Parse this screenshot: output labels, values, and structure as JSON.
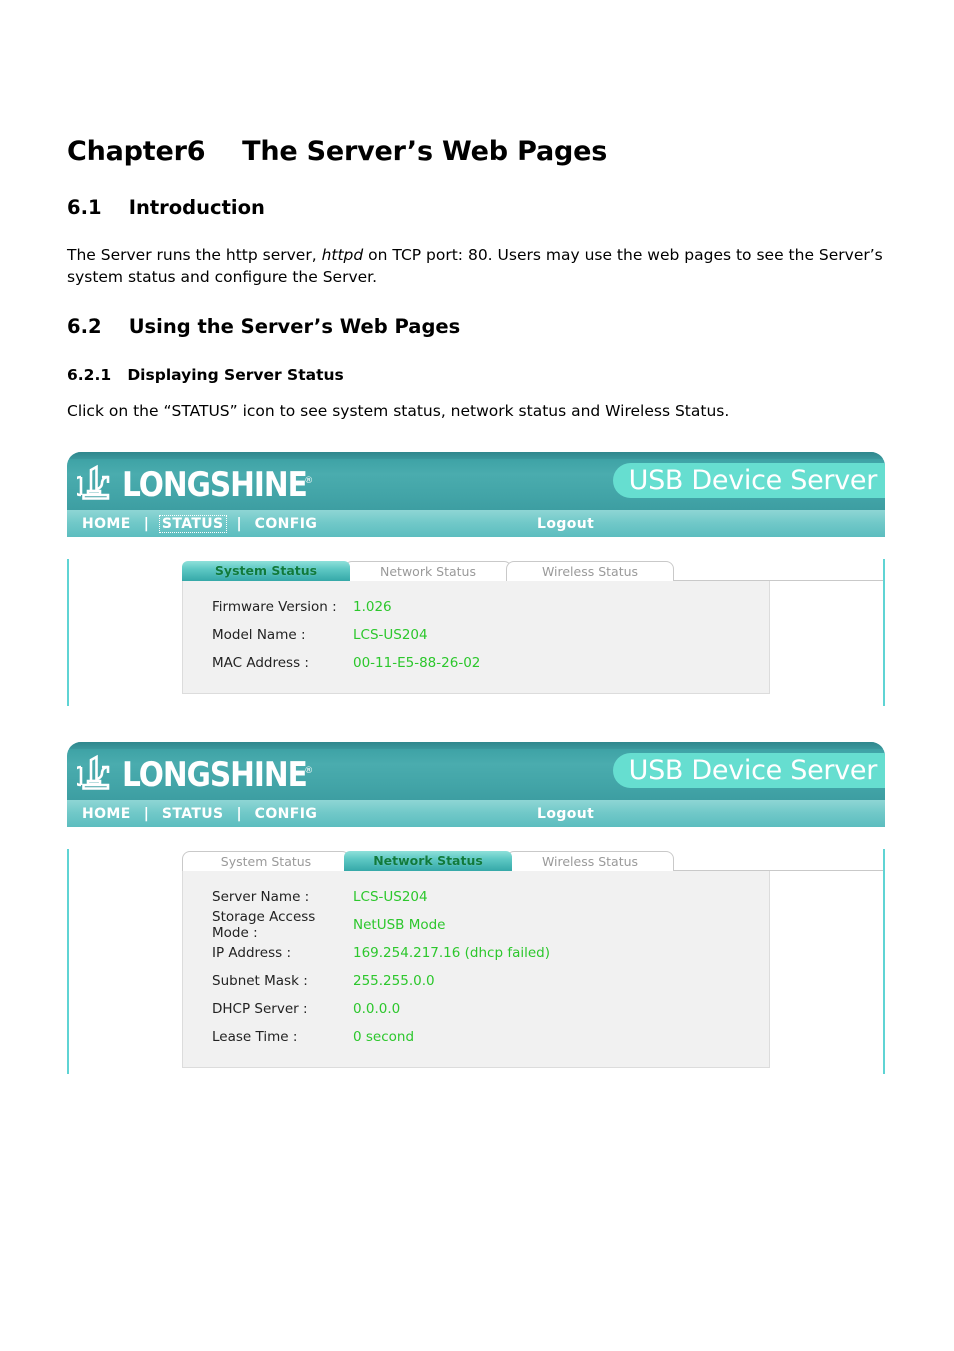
{
  "document": {
    "chapter_title": "Chapter6    The Server’s Web Pages",
    "section_61_title": "6.1    Introduction",
    "intro_paragraph": "The Server runs the http server, ",
    "intro_italic": "httpd",
    "intro_paragraph_cont": " on TCP port: 80. Users may use the web pages to see the Server’s system status and configure the Server.",
    "section_62_title": "6.2    Using the Server’s Web Pages",
    "section_621_title": "6.2.1   Displaying Server Status",
    "status_paragraph": "Click on the “STATUS” icon to see system status, network status and Wireless Status."
  },
  "colors": {
    "header_teal": "#43a5a8",
    "nav_teal": "#72c9c9",
    "badge_mint": "#66ded0",
    "border_teal": "#5fd4d4",
    "value_green": "#2cc72c",
    "active_tab_text": "#0f7a3c",
    "inactive_tab_text": "#9a9a9a",
    "field_bg": "#f1f1f1"
  },
  "screenshot1": {
    "logo_word": "LONGSHINE",
    "logo_registered": "®",
    "badge_label": "USB Device Server",
    "nav": {
      "items": [
        {
          "label": "HOME",
          "focused": false
        },
        {
          "label": "STATUS",
          "focused": true
        },
        {
          "label": "CONFIG",
          "focused": false
        }
      ],
      "separator": "|",
      "logout_label": "Logout"
    },
    "tabs": [
      {
        "label": "System Status",
        "active": true
      },
      {
        "label": "Network Status",
        "active": false
      },
      {
        "label": "Wireless Status",
        "active": false
      }
    ],
    "fields": [
      {
        "label": "Firmware Version :",
        "value": "1.026"
      },
      {
        "label": "Model Name :",
        "value": "LCS-US204"
      },
      {
        "label": "MAC Address :",
        "value": "00-11-E5-88-26-02"
      }
    ]
  },
  "screenshot2": {
    "logo_word": "LONGSHINE",
    "logo_registered": "®",
    "badge_label": "USB Device Server",
    "nav": {
      "items": [
        {
          "label": "HOME",
          "focused": false
        },
        {
          "label": "STATUS",
          "focused": false
        },
        {
          "label": "CONFIG",
          "focused": false
        }
      ],
      "separator": "|",
      "logout_label": "Logout"
    },
    "tabs": [
      {
        "label": "System Status",
        "active": false
      },
      {
        "label": "Network Status",
        "active": true
      },
      {
        "label": "Wireless Status",
        "active": false
      }
    ],
    "fields": [
      {
        "label": "Server Name :",
        "value": "LCS-US204"
      },
      {
        "label": "Storage Access Mode :",
        "value": "NetUSB Mode"
      },
      {
        "label": "IP Address :",
        "value": "169.254.217.16 (dhcp failed)"
      },
      {
        "label": "Subnet Mask :",
        "value": "255.255.0.0"
      },
      {
        "label": "DHCP Server :",
        "value": "0.0.0.0"
      },
      {
        "label": "Lease Time :",
        "value": "0 second"
      }
    ]
  }
}
